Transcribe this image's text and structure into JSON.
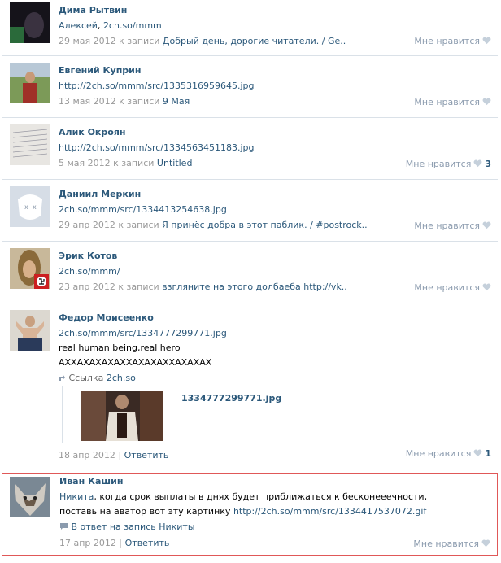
{
  "like_label": "Мне нравится",
  "colors": {
    "link": "#2b587a",
    "meta": "#999999",
    "border": "#dae1e8",
    "highlight": "#e05858",
    "like": "#8b9bae"
  },
  "comments": [
    {
      "name": "Дима Рытвин",
      "l1a": "Алексей",
      "l1b": ", ",
      "l1c": "2ch.so/mmm",
      "date": "29 мая 2012 к записи",
      "post": "Добрый день, дорогие читатели. / Ge.."
    },
    {
      "name": "Евгений Куприн",
      "text": "http://2ch.so/mmm/src/1335316959645.jpg",
      "date": "13 мая 2012 к записи",
      "post": "9 Мая"
    },
    {
      "name": "Алик Окроян",
      "text": "http://2ch.so/mmm/src/1334563451183.jpg",
      "date": "5 мая 2012 к записи",
      "post": "Untitled",
      "likes": "3"
    },
    {
      "name": "Даниил Меркин",
      "text": "2ch.so/mmm/src/1334413254638.jpg",
      "date": "29 апр 2012 к записи",
      "post": "Я принёс добра в этот паблик. / #postrock.."
    },
    {
      "name": "Эрик Котов",
      "text": "2ch.so/mmm/",
      "date": "23 апр 2012 к записи",
      "post": "взгляните на этого долбаеба http://vk.."
    },
    {
      "name": "Федор Моисеенко",
      "text": "2ch.so/mmm/src/1334777299771.jpg",
      "text2": "real human being,real hero",
      "text3": "АХХАХАХАХАХХАХАХАХХАХАХАХ",
      "attach_label": "Ссылка",
      "attach_site": "2ch.so",
      "file": "1334777299771.jpg",
      "date": "18 апр 2012",
      "reply": "Ответить",
      "likes": "1"
    },
    {
      "name": "Иван Кашин",
      "mention": "Никита",
      "t1": ", когда срок выплаты в днях будет приближаться к бесконееечности,",
      "t2": "поставь на аватор вот эту картинку ",
      "t2link": "http://2ch.so/mmm/src/1334417537072.gif",
      "reply_note": "В ответ на запись Никиты",
      "date": "17 апр 2012",
      "reply": "Ответить"
    }
  ]
}
